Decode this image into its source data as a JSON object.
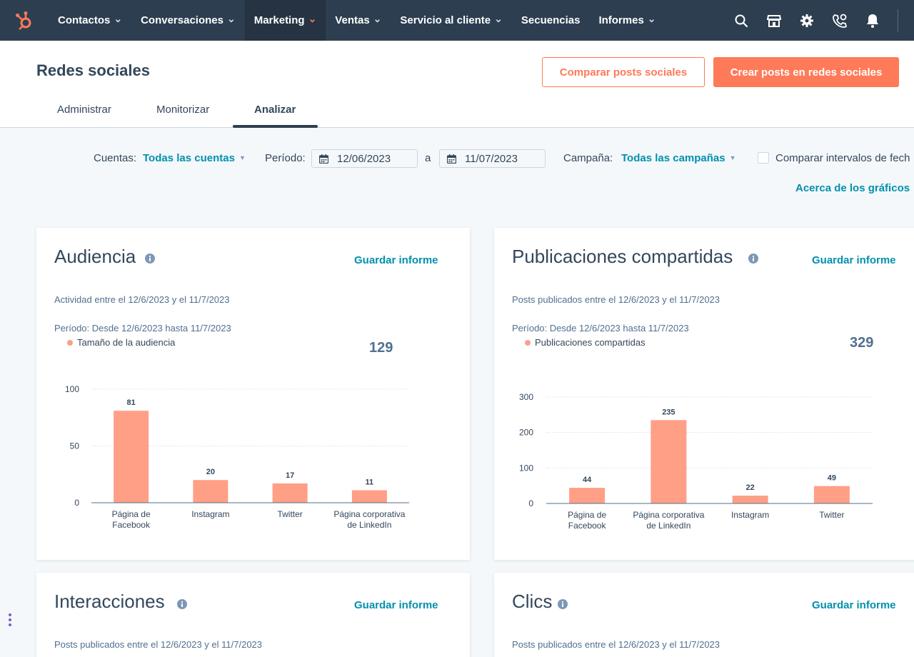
{
  "nav": {
    "logo": "hubspot-logo",
    "items": [
      {
        "label": "Contactos",
        "chevron": true
      },
      {
        "label": "Conversaciones",
        "chevron": true
      },
      {
        "label": "Marketing",
        "chevron": true,
        "active": true
      },
      {
        "label": "Ventas",
        "chevron": true
      },
      {
        "label": "Servicio al cliente",
        "chevron": true
      },
      {
        "label": "Secuencias",
        "chevron": false
      },
      {
        "label": "Informes",
        "chevron": true
      }
    ],
    "right_icons": [
      "search-icon",
      "marketplace-icon",
      "settings-icon",
      "calling-icon",
      "notifications-icon"
    ]
  },
  "header": {
    "title": "Redes sociales",
    "compare_button": "Comparar posts sociales",
    "create_button": "Crear posts en redes sociales",
    "tabs": [
      "Administrar",
      "Monitorizar",
      "Analizar"
    ],
    "active_tab": "Analizar"
  },
  "filters": {
    "accounts_label": "Cuentas:",
    "accounts_value": "Todas las cuentas",
    "period_label": "Período:",
    "date_from": "12/06/2023",
    "date_separator": "a",
    "date_to": "11/07/2023",
    "campaign_label": "Campaña:",
    "campaign_value": "Todas las campañas",
    "compare_label": "Comparar intervalos de fech",
    "about_link": "Acerca de los gráficos"
  },
  "cards": {
    "audience": {
      "title": "Audiencia",
      "save": "Guardar informe",
      "subtitle": "Actividad entre el 12/6/2023 y el 11/7/2023",
      "period": "Período:  Desde 12/6/2023 hasta 11/7/2023",
      "legend": "Tamaño de la audiencia",
      "total": "129"
    },
    "shares": {
      "title": "Publicaciones compartidas",
      "save": "Guardar informe",
      "subtitle": "Posts publicados entre el 12/6/2023 y el 11/7/2023",
      "period": "Período:  Desde 12/6/2023 hasta 11/7/2023",
      "legend": "Publicaciones compartidas",
      "total": "329"
    },
    "interactions": {
      "title": "Interacciones",
      "save": "Guardar informe",
      "subtitle": "Posts publicados entre el 12/6/2023 y el 11/7/2023"
    },
    "clicks": {
      "title": "Clics",
      "save": "Guardar informe",
      "subtitle": "Posts publicados entre el 12/6/2023 y el 11/7/2023"
    }
  },
  "colors": {
    "nav_bg": "#2d3e50",
    "accent": "#ff7a59",
    "link": "#0091ae",
    "bar": "#ff9f86"
  },
  "chart_data": [
    {
      "type": "bar",
      "title": "Audiencia",
      "categories": [
        "Página de\nFacebook",
        "Instagram",
        "Twitter",
        "Página corporativa\nde LinkedIn"
      ],
      "series": [
        {
          "name": "Tamaño de la audiencia",
          "values": [
            81,
            20,
            17,
            11
          ]
        }
      ],
      "yticks": [
        0,
        50,
        100
      ],
      "ylim": [
        0,
        100
      ],
      "grid": true
    },
    {
      "type": "bar",
      "title": "Publicaciones compartidas",
      "categories": [
        "Página de\nFacebook",
        "Página corporativa\nde LinkedIn",
        "Instagram",
        "Twitter"
      ],
      "series": [
        {
          "name": "Publicaciones compartidas",
          "values": [
            44,
            235,
            22,
            49
          ]
        }
      ],
      "yticks": [
        0,
        100,
        200,
        300
      ],
      "ylim": [
        0,
        300
      ],
      "grid": true
    }
  ]
}
